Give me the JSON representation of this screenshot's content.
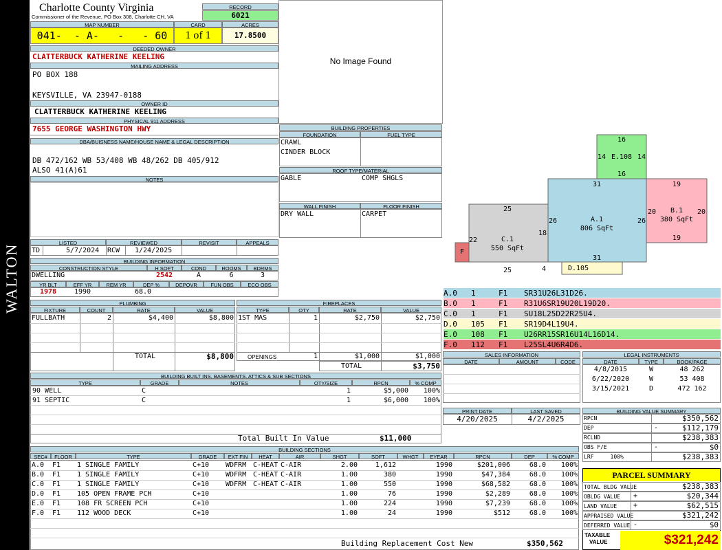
{
  "sidebar": {
    "name": "WALTON"
  },
  "header": {
    "county": "Charlotte County Virginia",
    "commissioner": "Commissioner of the Revenue, PO Box 308, Charlotte CH, VA",
    "record_label": "RECORD",
    "record": "6021",
    "map_label": "MAP NUMBER",
    "map_number": "041-  - A-   -   - 60",
    "card_label": "CARD",
    "card": "1 of 1",
    "acres_label": "ACRES",
    "acres": "17.8500"
  },
  "owner": {
    "deeded_label": "DEEDED OWNER",
    "deeded": "CLATTERBUCK KATHERINE KEELING",
    "mailing_label": "MAILING ADDRESS",
    "mail1": "PO BOX 188",
    "mail2": "KEYSVILLE, VA 23947-0188",
    "ownerid_label": "OWNER ID",
    "ownerid": "CLATTERBUCK KATHERINE KEELING",
    "addr_label": "PHYSICAL 911 ADDRESS",
    "addr": "7655 GEORGE WASHINGTON HWY",
    "dba_label": "DBA/BUISNESS NAME/HOUSE NAME & LEGAL DESCRIPTION",
    "legal1": "DB 472/162 WB 53/408 WB 48/262 DB 405/912",
    "legal2": "ALSO 41(A)61",
    "notes_label": "NOTES"
  },
  "photo": {
    "text": "No Image Found"
  },
  "props": {
    "title": "BUILDING PROPERTIES",
    "foundation_label": "FOUNDATION",
    "fuel_label": "FUEL TYPE",
    "foundation1": "CRAWL",
    "foundation2": "CINDER BLOCK",
    "roof_label": "ROOF TYPE/MATERIAL",
    "roof_type": "GABLE",
    "roof_mat": "COMP SHGLS",
    "wall_label": "WALL FINISH",
    "floor_label": "FLOOR FINISH",
    "wall": "DRY WALL",
    "floor": "CARPET"
  },
  "review": {
    "listed_label": "LISTED",
    "reviewed_label": "REVIEWED",
    "revisit_label": "REVISIT",
    "appeals_label": "APPEALS",
    "listed_by": "TD",
    "listed": "5/7/2024",
    "reviewed_by": "RCW",
    "reviewed": "1/24/2025"
  },
  "info": {
    "title": "BUILDING INFORMATION",
    "style_label": "CONSTRUCTION STYLE",
    "hsqft_label": "H SQFT",
    "cond_label": "COND",
    "rooms_label": "ROOMS",
    "bdrms_label": "BDRMS",
    "style": "DWELLING",
    "hsqft": "2542",
    "cond": "A",
    "rooms": "6",
    "bdrms": "3",
    "yrblt_label": "YR BLT",
    "effyr_label": "EFF YR",
    "remyr_label": "REM YR",
    "dep_label": "DEP %",
    "depovr_label": "DEPOVR",
    "funobs_label": "FUN OBS",
    "ecoobs_label": "ECO OBS",
    "yrblt": "1978",
    "effyr": "1990",
    "dep": "68.0"
  },
  "plumbing": {
    "title": "PLUMBING",
    "h": [
      "FIXTURE",
      "COUNT",
      "RATE",
      "VALUE"
    ],
    "rows": [
      [
        "FULLBATH",
        "2",
        "$4,400",
        "$8,800"
      ]
    ],
    "total_label": "TOTAL",
    "total": "$8,800"
  },
  "fireplaces": {
    "title": "FIREPLACES",
    "h": [
      "TYPE",
      "QTY",
      "RATE",
      "VALUE"
    ],
    "rows": [
      [
        "1ST MAS",
        "1",
        "$2,750",
        "$2,750"
      ]
    ],
    "openings_label": "OPENINGS",
    "openings_qty": "1",
    "openings_rate": "$1,000",
    "openings_value": "$1,000",
    "total_label": "TOTAL",
    "total": "$3,750"
  },
  "builtins": {
    "title": "BUILDING BUILT INS, BASEMENTS, ATTICS & SUB SECTIONS",
    "h": [
      "TYPE",
      "GRADE",
      "NOTES",
      "QTY/SIZE",
      "RPCN",
      "% COMP"
    ],
    "rows": [
      [
        "90 WELL",
        "C",
        "",
        "1",
        "$5,000",
        "100%"
      ],
      [
        "91 SEPTIC",
        "C",
        "",
        "1",
        "$6,000",
        "100%"
      ]
    ],
    "total_label": "Total Built In Value",
    "total": "$11,000"
  },
  "sketch": {
    "sections": [
      {
        "code": "A.0",
        "num": "1",
        "fl": "F1",
        "desc": "SR31U26L31D26.",
        "color": "#add8e6"
      },
      {
        "code": "B.0",
        "num": "1",
        "fl": "F1",
        "desc": "R31U6SR19U20L19D20.",
        "color": "#ffb6c1"
      },
      {
        "code": "C.0",
        "num": "1",
        "fl": "F1",
        "desc": "SU18L25D22R25U4.",
        "color": "#d3d3d3"
      },
      {
        "code": "D.0",
        "num": "105",
        "fl": "F1",
        "desc": "SR19D4L19U4.",
        "color": "#fffacd"
      },
      {
        "code": "E.0",
        "num": "108",
        "fl": "F1",
        "desc": "U26RR15SR16U14L16D14.",
        "color": "#90ee90"
      },
      {
        "code": "F.0",
        "num": "112",
        "fl": "F1",
        "desc": "L25SL4U6R4D6.",
        "color": "#e57373"
      }
    ],
    "a_label": "A.1",
    "a_area": "806 SqFt",
    "b_label": "B.1",
    "b_area": "380 SqFt",
    "c_label": "C.1",
    "c_area": "550 SqFt",
    "d_label": "D.105",
    "e_label": "E.108",
    "f_label": "F",
    "dims": {
      "a_top": "31",
      "a_bot": "31",
      "a_left": "26",
      "a_right": "26",
      "b_top": "19",
      "b_bot": "19",
      "b_left": "20",
      "b_right": "20",
      "c_top": "25",
      "c_bot": "25",
      "c_left": "22",
      "c_right": "18",
      "c_four": "4",
      "e_top": "16",
      "e_bot": "16",
      "e_left": "14",
      "e_right": "14"
    }
  },
  "sales": {
    "title": "SALES INFORMATION",
    "h": [
      "DATE",
      "AMOUNT",
      "CODE"
    ]
  },
  "legal": {
    "title": "LEGAL INSTRUMENTS",
    "h": [
      "DATE",
      "TYPE",
      "BOOK/PAGE"
    ],
    "rows": [
      [
        "4/8/2015",
        "W",
        "48 262"
      ],
      [
        "6/22/2020",
        "W",
        "53 408"
      ],
      [
        "3/15/2021",
        "D",
        "472 162"
      ]
    ]
  },
  "dates": {
    "print_label": "PRINT DATE",
    "print": "4/20/2025",
    "saved_label": "LAST SAVED",
    "saved": "4/2/2025"
  },
  "valsum": {
    "title": "BUILDING VALUE SUMMARY",
    "rows": [
      [
        "RPCN",
        "",
        "$350,562"
      ],
      [
        "DEP",
        "-",
        "$112,179"
      ],
      [
        "RCLND",
        "",
        "$238,383"
      ],
      [
        "OBS F/E",
        "-",
        "$0"
      ],
      [
        "LRF     100%",
        "",
        "$238,383"
      ]
    ]
  },
  "parcel": {
    "title": "PARCEL SUMMARY",
    "rows": [
      [
        "TOTAL BLDG VALUE",
        "",
        "$238,383"
      ],
      [
        "OBLDG VALUE",
        "+",
        "$20,344"
      ],
      [
        "LAND VALUE",
        "+",
        "$62,515"
      ],
      [
        "APPRAISED VALUE",
        "",
        "$321,242"
      ],
      [
        "DEFERRED VALUE",
        "-",
        "$0"
      ]
    ],
    "taxable_label1": "TAXABLE",
    "taxable_label2": "VALUE",
    "taxable": "$321,242"
  },
  "sections": {
    "title": "BUILDING SECTIONS",
    "h": [
      "SEC#",
      "FLOOR",
      "TYPE",
      "GRADE",
      "EXT FIN",
      "HEAT",
      "AIR",
      "SHGT",
      "SQFT",
      "WHGT",
      "EYEAR",
      "RPCN",
      "DEP",
      "% COMP"
    ],
    "rows": [
      [
        "A.0",
        "F1",
        "1 SINGLE FAMILY",
        "C+10",
        "WDFRM",
        "C-HEAT",
        "C-AIR",
        "2.00",
        "1,612",
        "",
        "1990",
        "$201,006",
        "68.0",
        "100%"
      ],
      [
        "B.0",
        "F1",
        "1 SINGLE FAMILY",
        "C+10",
        "WDFRM",
        "C-HEAT",
        "C-AIR",
        "1.00",
        "380",
        "",
        "1990",
        "$47,384",
        "68.0",
        "100%"
      ],
      [
        "C.0",
        "F1",
        "1 SINGLE FAMILY",
        "C+10",
        "WDFRM",
        "C-HEAT",
        "C-AIR",
        "1.00",
        "550",
        "",
        "1990",
        "$68,582",
        "68.0",
        "100%"
      ],
      [
        "D.0",
        "F1",
        "105 OPEN FRAME PCH",
        "C+10",
        "",
        "",
        "",
        "1.00",
        "76",
        "",
        "1990",
        "$2,289",
        "68.0",
        "100%"
      ],
      [
        "E.0",
        "F1",
        "108 FR SCREEN PCH",
        "C+10",
        "",
        "",
        "",
        "1.00",
        "224",
        "",
        "1990",
        "$7,239",
        "68.0",
        "100%"
      ],
      [
        "F.0",
        "F1",
        "112 WOOD DECK",
        "C+10",
        "",
        "",
        "",
        "1.00",
        "24",
        "",
        "1990",
        "$512",
        "68.0",
        "100%"
      ]
    ],
    "brcn_label": "Building Replacement Cost New",
    "brcn": "$350,562"
  }
}
